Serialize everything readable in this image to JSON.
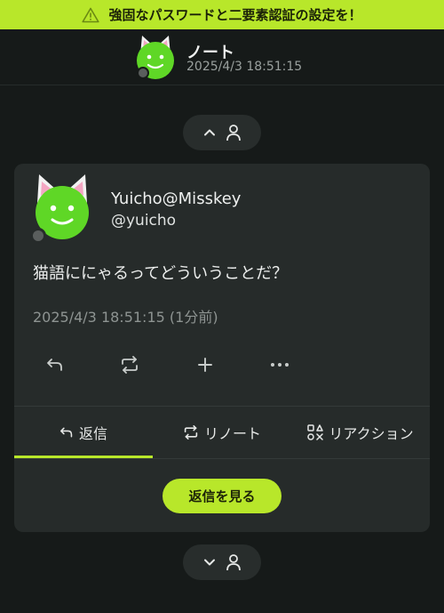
{
  "banner": {
    "text": "強固なパスワードと二要素認証の設定を！",
    "icon": "warning-icon"
  },
  "header": {
    "title": "ノート",
    "timestamp": "2025/4/3 18:51:15"
  },
  "top_pill": {
    "icons": [
      "chevron-up-icon",
      "user-icon"
    ]
  },
  "note": {
    "author_name": "Yuicho@Misskey",
    "author_handle": "@yuicho",
    "text": "猫語ににゃるってどういうことだ？",
    "timestamp": "2025/4/3 18:51:15 (1分前)",
    "actions": [
      "reply-icon",
      "renote-icon",
      "plus-icon",
      "more-icon"
    ]
  },
  "tabs": [
    {
      "label": "返信",
      "icon": "reply-icon",
      "active": true
    },
    {
      "label": "リノート",
      "icon": "renote-icon",
      "active": false
    },
    {
      "label": "リアクション",
      "icon": "reaction-icon",
      "active": false
    }
  ],
  "see_replies_label": "返信を見る",
  "bottom_pill": {
    "icons": [
      "chevron-down-icon",
      "user-icon"
    ]
  },
  "colors": {
    "accent": "#b8e72a",
    "background": "#161a19",
    "card": "#262b2a",
    "muted": "#8e9492"
  }
}
